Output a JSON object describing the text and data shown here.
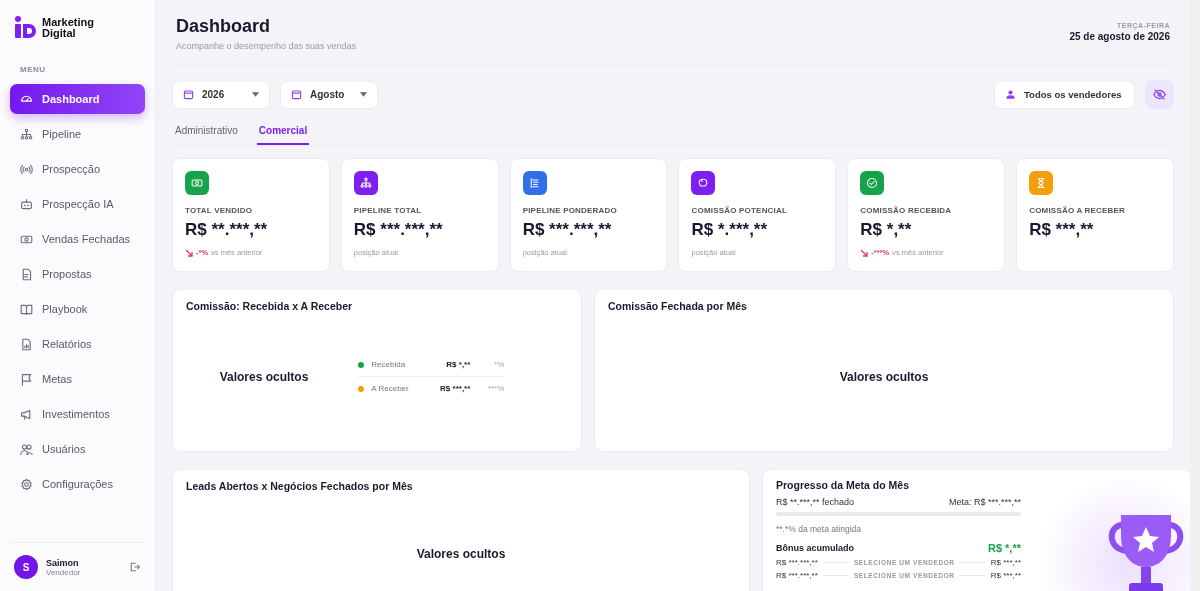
{
  "sidebar": {
    "brand": [
      "Marketing",
      "Digital"
    ],
    "menu_label": "MENU",
    "items": [
      {
        "label": "Dashboard",
        "selected": true
      },
      {
        "label": "Pipeline",
        "selected": false
      },
      {
        "label": "Prospecção",
        "selected": false
      },
      {
        "label": "Prospecção IA",
        "selected": false
      },
      {
        "label": "Vendas Fechadas",
        "selected": false
      },
      {
        "label": "Propostas",
        "selected": false
      },
      {
        "label": "Playbook",
        "selected": false
      },
      {
        "label": "Relatórios",
        "selected": false
      },
      {
        "label": "Metas",
        "selected": false
      },
      {
        "label": "Investimentos",
        "selected": false
      },
      {
        "label": "Usuários",
        "selected": false
      },
      {
        "label": "Configurações",
        "selected": false
      }
    ],
    "user": {
      "initial": "S",
      "name": "Saimon",
      "role": "Vendedor"
    }
  },
  "header": {
    "title": "Dashboard",
    "subtitle": "Acompanhe o desempenho das suas vendas",
    "weekday": "TERÇA-FEIRA",
    "date": "25 de agosto de 2026"
  },
  "filters": {
    "year": "2026",
    "month": "Agosto",
    "seller": "Todos os vendedores"
  },
  "tabs": [
    {
      "label": "Administrativo",
      "selected": false
    },
    {
      "label": "Comercial",
      "selected": true
    }
  ],
  "kpis": [
    {
      "label": "TOTAL VENDIDO",
      "value": "R$ **.***,**",
      "color": "#16a34a",
      "note": {
        "kind": "trend",
        "change": "-*%",
        "text": "vs mês anterior"
      }
    },
    {
      "label": "PIPELINE TOTAL",
      "value": "R$ ***.***,**",
      "color": "#7c1ff0",
      "note": {
        "kind": "plain",
        "text": "posição atual"
      }
    },
    {
      "label": "PIPELINE PONDERADO",
      "value": "R$ ***.***,**",
      "color": "#2f6fe8",
      "note": {
        "kind": "plain",
        "text": "posição atual"
      }
    },
    {
      "label": "COMISSÃO POTENCIAL",
      "value": "R$ *.***,**",
      "color": "#7c1ff0",
      "note": {
        "kind": "plain",
        "text": "posição atual"
      }
    },
    {
      "label": "COMISSÃO RECEBIDA",
      "value": "R$ *,**",
      "color": "#16a34a",
      "note": {
        "kind": "trend",
        "change": "-***%",
        "text": "vs mês anterior"
      }
    },
    {
      "label": "COMISSÃO A RECEBER",
      "value": "R$ ***,**",
      "color": "#f59e0b"
    }
  ],
  "commission_split": {
    "title": "Comissão: Recebida x A Receber",
    "hidden_text": "Valores ocultos",
    "legend": [
      {
        "label": "Recebida",
        "value": "R$ *,**",
        "percent": "*%",
        "color": "#16a34a"
      },
      {
        "label": "A Receber",
        "value": "R$ ***,**",
        "percent": "***%",
        "color": "#f59e0b"
      }
    ]
  },
  "monthly_commission": {
    "title": "Comissão Fechada por Mês",
    "hidden_text": "Valores ocultos"
  },
  "leads_vs_deals": {
    "title": "Leads Abertos x Negócios Fechados por Mês",
    "hidden_text": "Valores ocultos"
  },
  "goal": {
    "title": "Progresso da Meta do Mês",
    "closed": "R$ **.***,** fechado",
    "target": "Meta: R$ ***.***,**",
    "level": 0,
    "percent_text": "**.*% da meta atingida",
    "bonus_label": "Bônus acumulado",
    "bonus_value": "R$ *,**",
    "rows": [
      {
        "left": "R$ ***.***,**",
        "middle": "SELECIONE UM VENDEDOR",
        "right": "R$ ***,**"
      },
      {
        "left": "R$ ***.***,**",
        "middle": "SELECIONE UM VENDEDOR",
        "right": "R$ ***,**"
      }
    ]
  }
}
